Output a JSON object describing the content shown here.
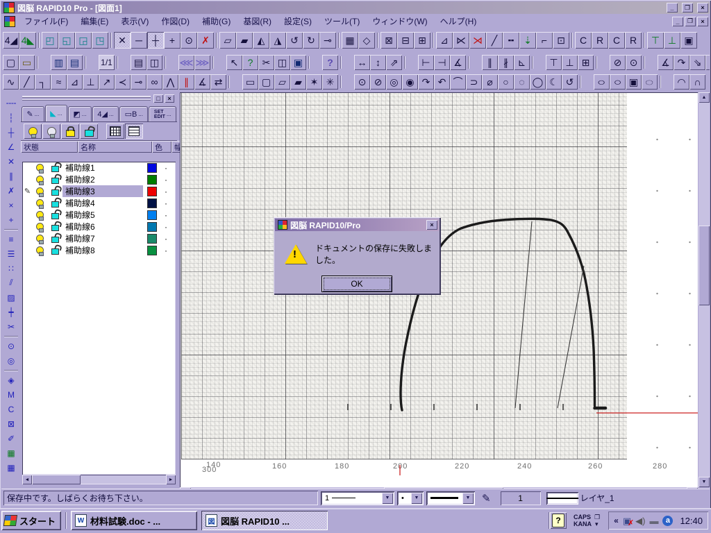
{
  "window": {
    "title": "図脳 RAPID10 Pro - [図面1]",
    "buttons": {
      "minimize": "_",
      "restore": "❐",
      "close": "×"
    }
  },
  "menu": {
    "items": [
      {
        "n": "menu-file",
        "label": "ファイル(F)"
      },
      {
        "n": "menu-edit",
        "label": "編集(E)"
      },
      {
        "n": "menu-view",
        "label": "表示(V)"
      },
      {
        "n": "menu-draw",
        "label": "作図(D)"
      },
      {
        "n": "menu-assist",
        "label": "補助(G)"
      },
      {
        "n": "menu-basefig",
        "label": "基図(R)"
      },
      {
        "n": "menu-settings",
        "label": "設定(S)"
      },
      {
        "n": "menu-tools",
        "label": "ツール(T)"
      },
      {
        "n": "menu-window",
        "label": "ウィンドウ(W)"
      },
      {
        "n": "menu-help",
        "label": "ヘルプ(H)"
      }
    ]
  },
  "toolbar1": {
    "items": [
      {
        "n": "layer-edit-all-icon",
        "g": "4◢"
      },
      {
        "n": "layer-view-all-icon",
        "g": "4◣",
        "cls": "green"
      },
      {
        "n": "sep",
        "g": "",
        "cls": "sep"
      },
      {
        "n": "layer-stack-1-icon",
        "g": "◰",
        "cls": "teal"
      },
      {
        "n": "layer-stack-2-icon",
        "g": "◱",
        "cls": "teal"
      },
      {
        "n": "layer-stack-3-icon",
        "g": "◲",
        "cls": "teal"
      },
      {
        "n": "layer-stack-4-icon",
        "g": "◳",
        "cls": "teal"
      },
      {
        "n": "sep",
        "g": "",
        "cls": "sep"
      },
      {
        "n": "snap-free-icon",
        "g": "✕",
        "cls": "pressed"
      },
      {
        "n": "snap-endpoint-icon",
        "g": "─"
      },
      {
        "n": "snap-intersection-icon",
        "g": "┼",
        "cls": "pressed"
      },
      {
        "n": "snap-point-icon",
        "g": "+"
      },
      {
        "n": "snap-center-icon",
        "g": "⊙"
      },
      {
        "n": "snap-none-icon",
        "g": "✗",
        "cls": "red"
      },
      {
        "n": "sep",
        "g": "",
        "cls": "sep"
      },
      {
        "n": "shape-copy-icon",
        "g": "▱"
      },
      {
        "n": "shape-move-icon",
        "g": "▰"
      },
      {
        "n": "mirror-left-icon",
        "g": "◭"
      },
      {
        "n": "mirror-right-icon",
        "g": "◮"
      },
      {
        "n": "rotate-ccw-icon",
        "g": "↺"
      },
      {
        "n": "rotate-cw-icon",
        "g": "↻"
      },
      {
        "n": "stretch-icon",
        "g": "⊸"
      },
      {
        "n": "sep",
        "g": "",
        "cls": "sep"
      },
      {
        "n": "array-grid-icon",
        "g": "▦"
      },
      {
        "n": "array-ref-icon",
        "g": "◇"
      },
      {
        "n": "sep",
        "g": "",
        "cls": "sep"
      },
      {
        "n": "erase-partial-icon",
        "g": "⊠"
      },
      {
        "n": "erase-region-icon",
        "g": "⊟"
      },
      {
        "n": "erase-all-icon",
        "g": "⊞"
      },
      {
        "n": "sep",
        "g": "",
        "cls": "sep"
      },
      {
        "n": "trim-corner-icon",
        "g": "⊿"
      },
      {
        "n": "trim-cross-icon",
        "g": "⋉"
      },
      {
        "n": "trim-cut-icon",
        "g": "⋊",
        "cls": "red"
      },
      {
        "n": "line-extend-icon",
        "g": "╱"
      },
      {
        "n": "line-break-icon",
        "g": "╍"
      },
      {
        "n": "divide-icon",
        "g": "⇣",
        "cls": "green"
      },
      {
        "n": "corner-edit-icon",
        "g": "⌐"
      },
      {
        "n": "region-box-icon",
        "g": "⊡"
      },
      {
        "n": "sep",
        "g": "",
        "cls": "sep"
      },
      {
        "n": "copy-attr-c-icon",
        "g": "C"
      },
      {
        "n": "copy-attr-r-icon",
        "g": "R"
      },
      {
        "n": "paste-attr-c-icon",
        "g": "C"
      },
      {
        "n": "paste-attr-r-icon",
        "g": "R"
      },
      {
        "n": "sep",
        "g": "",
        "cls": "sep"
      },
      {
        "n": "align-top-icon",
        "g": "⊤",
        "cls": "green"
      },
      {
        "n": "align-bottom-icon",
        "g": "⊥",
        "cls": "green"
      },
      {
        "n": "group-icon",
        "g": "▣"
      }
    ]
  },
  "toolbar2": {
    "items": [
      {
        "n": "new-document-icon",
        "g": "▢"
      },
      {
        "n": "open-document-icon",
        "g": "▭",
        "cls": "folder"
      },
      {
        "n": "sep",
        "g": "",
        "cls": "sep"
      },
      {
        "n": "save-icon",
        "g": "▥",
        "cls": "navy"
      },
      {
        "n": "save-page-icon",
        "g": "▤",
        "cls": "navy"
      },
      {
        "n": "sep",
        "g": "",
        "cls": "sep"
      },
      {
        "n": "page-indicator",
        "g": "1/1",
        "cls": "page"
      },
      {
        "n": "sep",
        "g": "",
        "cls": "sep"
      },
      {
        "n": "print-icon",
        "g": "▤"
      },
      {
        "n": "print-preview-icon",
        "g": "◫"
      },
      {
        "n": "sep",
        "g": "",
        "cls": "sep"
      },
      {
        "n": "undo-icon",
        "g": "⋘",
        "cls": "purple"
      },
      {
        "n": "redo-icon",
        "g": "⋙",
        "cls": "purple"
      },
      {
        "n": "sep",
        "g": "",
        "cls": "sep"
      },
      {
        "n": "select-cursor-icon",
        "g": "↖"
      },
      {
        "n": "zoom-query-icon",
        "g": "?",
        "cls": "green"
      },
      {
        "n": "cut-icon",
        "g": "✂"
      },
      {
        "n": "copy-icon",
        "g": "◫"
      },
      {
        "n": "paste-icon",
        "g": "▣",
        "cls": "navy"
      },
      {
        "n": "sep",
        "g": "",
        "cls": "sep"
      },
      {
        "n": "context-help-icon",
        "g": "?",
        "cls": "help"
      },
      {
        "n": "sep",
        "g": "",
        "cls": "sep"
      },
      {
        "n": "dim-horizontal-icon",
        "g": "↔"
      },
      {
        "n": "dim-vertical-icon",
        "g": "↕"
      },
      {
        "n": "dim-rotated-icon",
        "g": "⇗"
      },
      {
        "n": "sep",
        "g": "",
        "cls": "sep"
      },
      {
        "n": "dim-length-icon",
        "g": "⊢"
      },
      {
        "n": "dim-offset-icon",
        "g": "⊣"
      },
      {
        "n": "dim-angle3-icon",
        "g": "∡"
      },
      {
        "n": "sep",
        "g": "",
        "cls": "sep"
      },
      {
        "n": "dim-parallel-icon",
        "g": "∥"
      },
      {
        "n": "dim-chain-icon",
        "g": "∦"
      },
      {
        "n": "dim-baseline-icon",
        "g": "⊾"
      },
      {
        "n": "sep",
        "g": "",
        "cls": "sep"
      },
      {
        "n": "dim-ordinate-icon",
        "g": "⊤"
      },
      {
        "n": "dim-leader-icon",
        "g": "⊥"
      },
      {
        "n": "dim-box-icon",
        "g": "⊞"
      },
      {
        "n": "sep",
        "g": "",
        "cls": "sep"
      },
      {
        "n": "dim-diameter-icon",
        "g": "⊘"
      },
      {
        "n": "dim-radius-icon",
        "g": "⊙"
      },
      {
        "n": "sep",
        "g": "",
        "cls": "sep"
      },
      {
        "n": "dim-angle-icon",
        "g": "∡"
      },
      {
        "n": "dim-arc-icon",
        "g": "↷"
      },
      {
        "n": "dim-note-icon",
        "g": "⇘"
      },
      {
        "n": "dim-tolerance-icon",
        "g": "#"
      }
    ]
  },
  "toolbar3": {
    "items": [
      {
        "n": "polyline-icon",
        "g": "∿"
      },
      {
        "n": "line-icon",
        "g": "╱"
      },
      {
        "n": "bent-line-icon",
        "g": "┐"
      },
      {
        "n": "spline-icon",
        "g": "≈"
      },
      {
        "n": "angle-line-icon",
        "g": "⊿"
      },
      {
        "n": "perpendicular-line-icon",
        "g": "⊥"
      },
      {
        "n": "arrow-line-icon",
        "g": "↗"
      },
      {
        "n": "bisector-icon",
        "g": "≺"
      },
      {
        "n": "tangent-line-icon",
        "g": "⊸"
      },
      {
        "n": "two-circle-tangent-icon",
        "g": "∞"
      },
      {
        "n": "double-peak-icon",
        "g": "⋀"
      },
      {
        "n": "hatch-lines-icon",
        "g": "∥",
        "cls": "red"
      },
      {
        "n": "angle-mark-icon",
        "g": "∡"
      },
      {
        "n": "swap-line-icon",
        "g": "⇄"
      },
      {
        "n": "sep",
        "g": "",
        "cls": "sep"
      },
      {
        "n": "rectangle-icon",
        "g": "▭"
      },
      {
        "n": "rounded-rect-icon",
        "g": "▢"
      },
      {
        "n": "parallelogram-icon",
        "g": "▱"
      },
      {
        "n": "rect-3point-icon",
        "g": "▰"
      },
      {
        "n": "polygon-icon",
        "g": "✶"
      },
      {
        "n": "polygon-star-icon",
        "g": "✳"
      },
      {
        "n": "sep",
        "g": "",
        "cls": "sep"
      },
      {
        "n": "circle-center-icon",
        "g": "⊙"
      },
      {
        "n": "circle-diameter-icon",
        "g": "⊘"
      },
      {
        "n": "circle-2point-icon",
        "g": "◎"
      },
      {
        "n": "concentric-circle-icon",
        "g": "◉"
      },
      {
        "n": "arc-start-icon",
        "g": "↷"
      },
      {
        "n": "arc-3point-icon",
        "g": "↶"
      },
      {
        "n": "arc-tangent-icon",
        "g": "⌒"
      },
      {
        "n": "circle-tangent-icon",
        "g": "⊃"
      },
      {
        "n": "circle-cut-icon",
        "g": "⌀"
      },
      {
        "n": "circle-open-icon",
        "g": "○"
      },
      {
        "n": "circle-point-icon",
        "g": "◌"
      },
      {
        "n": "circle-large-icon",
        "g": "◯"
      },
      {
        "n": "circle-gap-icon",
        "g": "☾"
      },
      {
        "n": "circle-rotate-icon",
        "g": "↺"
      },
      {
        "n": "sep",
        "g": "",
        "cls": "sep"
      },
      {
        "n": "ellipse-icon",
        "g": "○",
        "cls": "ellipse"
      },
      {
        "n": "ellipse-rotated-icon",
        "g": "○",
        "cls": "ellipse tilt"
      },
      {
        "n": "ellipse-box-icon",
        "g": "▣"
      },
      {
        "n": "ellipse-dashed-icon",
        "g": "◌",
        "cls": "ellipse"
      },
      {
        "n": "sep",
        "g": "",
        "cls": "sep"
      },
      {
        "n": "arc-icon",
        "g": "◠"
      },
      {
        "n": "arc-wave-icon",
        "g": "∩"
      }
    ]
  },
  "side_toolbar": {
    "items": [
      {
        "n": "aux-dash-icon",
        "g": "╌╌"
      },
      {
        "n": "aux-vline-icon",
        "g": "┆"
      },
      {
        "n": "aux-cross-icon",
        "g": "┼"
      },
      {
        "n": "aux-angle-icon",
        "g": "∠"
      },
      {
        "n": "aux-xpoint-icon",
        "g": "✕"
      },
      {
        "n": "aux-parallel-icon",
        "g": "∥"
      },
      {
        "n": "aux-cross2-icon",
        "g": "✗"
      },
      {
        "n": "aux-x-icon",
        "g": "×"
      },
      {
        "n": "aux-plus-icon",
        "g": "+"
      },
      {
        "n": "sep",
        "g": "",
        "cls": "sep"
      },
      {
        "n": "grid-rows-icon",
        "g": "≡"
      },
      {
        "n": "grid-bars-icon",
        "g": "☰"
      },
      {
        "n": "grid-dots-icon",
        "g": "∷"
      },
      {
        "n": "hatch-diag-icon",
        "g": "⫽"
      },
      {
        "n": "hatch-cross-icon",
        "g": "▨"
      },
      {
        "n": "marker-plus-icon",
        "g": "┿"
      },
      {
        "n": "cut-marks-icon",
        "g": "✂"
      },
      {
        "n": "sep",
        "g": "",
        "cls": "sep"
      },
      {
        "n": "circle-dot-icon",
        "g": "⊙"
      },
      {
        "n": "circle-double-icon",
        "g": "◎"
      },
      {
        "n": "sep",
        "g": "",
        "cls": "sep"
      },
      {
        "n": "point-diamond-icon",
        "g": "◈"
      },
      {
        "n": "box-m-icon",
        "g": "M"
      },
      {
        "n": "box-c-icon",
        "g": "C"
      },
      {
        "n": "erase-small-icon",
        "g": "⊠"
      },
      {
        "n": "mouse-icon",
        "g": "✐"
      },
      {
        "n": "window-green-icon",
        "g": "▦",
        "cls": "green"
      },
      {
        "n": "window-blue-icon",
        "g": "▦"
      }
    ]
  },
  "palette": {
    "window_buttons": {
      "maximize": "□",
      "close": "×"
    },
    "tabs": [
      {
        "n": "tab-pen",
        "icon": "✎",
        "dots": "..."
      },
      {
        "n": "tab-layers",
        "icon": "◣",
        "dots": "...",
        "cls": "active cyan"
      },
      {
        "n": "tab-figure",
        "icon": "◩",
        "dots": "..."
      },
      {
        "n": "tab-parts",
        "icon": "4◢",
        "dots": "..."
      },
      {
        "n": "tab-block",
        "icon": "▭B",
        "dots": "..."
      },
      {
        "n": "tab-set-edit",
        "icon": "SET\nEDIT",
        "dots": "...",
        "cls": "text"
      }
    ],
    "columns": [
      {
        "n": "col-status",
        "t": "状態",
        "style": "width:78px"
      },
      {
        "n": "col-name",
        "t": "名称",
        "style": "width:103px"
      },
      {
        "n": "col-color",
        "t": "色",
        "style": "width:24px"
      },
      {
        "n": "col-width",
        "t": "幅",
        "style": "width:16px"
      }
    ],
    "rows": [
      {
        "n": "layer-row-1",
        "name": "補助線1",
        "chip": "background:#0008e0",
        "marker": "",
        "cls": "",
        "dot": "·"
      },
      {
        "n": "layer-row-2",
        "name": "補助線2",
        "chip": "background:#007d00",
        "marker": "",
        "cls": "",
        "dot": "·"
      },
      {
        "n": "layer-row-3",
        "name": "補助線3",
        "chip": "background:#ee0000",
        "marker": "✎",
        "cls": "sel",
        "dot": "·"
      },
      {
        "n": "layer-row-4",
        "name": "補助線4",
        "chip": "background:#001245",
        "marker": "",
        "cls": "",
        "dot": "·"
      },
      {
        "n": "layer-row-5",
        "name": "補助線5",
        "chip": "background:#0080f0",
        "marker": "",
        "cls": "",
        "dot": "·"
      },
      {
        "n": "layer-row-6",
        "name": "補助線6",
        "chip": "background:#0078b0",
        "marker": "",
        "cls": "",
        "dot": "·"
      },
      {
        "n": "layer-row-7",
        "name": "補助線7",
        "chip": "background:#1a8a6a",
        "marker": "",
        "cls": "",
        "dot": "·"
      },
      {
        "n": "layer-row-8",
        "name": "補助線8",
        "chip": "background:#089040",
        "marker": "",
        "cls": "",
        "dot": "·"
      }
    ]
  },
  "drawing": {
    "axis_labels": [
      {
        "n": "axis-label-140",
        "t": "140",
        "style": "left:36px;top:2px"
      },
      {
        "n": "axis-label-300",
        "t": "300",
        "style": "left:30px;top:9px"
      },
      {
        "n": "axis-label-160",
        "t": "160",
        "style": "left:131px;top:4px"
      },
      {
        "n": "axis-label-180",
        "t": "180",
        "style": "left:221px;top:4px"
      },
      {
        "n": "axis-label-200",
        "t": "200",
        "style": "left:305px;top:4px"
      },
      {
        "n": "axis-label-220",
        "t": "220",
        "style": "left:394px;top:4px"
      },
      {
        "n": "axis-label-240",
        "t": "240",
        "style": "left:484px;top:4px"
      },
      {
        "n": "axis-label-260",
        "t": "260",
        "style": "left:586px;top:4px"
      },
      {
        "n": "axis-label-280",
        "t": "280",
        "style": "left:679px;top:4px"
      }
    ]
  },
  "dialog": {
    "title": "図脳 RAPID10/Pro",
    "close": "×",
    "message": "ドキュメントの保存に失敗しました。",
    "ok_label": "OK"
  },
  "statusbar": {
    "message": "保存中です。しばらくお待ち下さい。",
    "line_width_value": "1",
    "point_style": "•",
    "pen_number": "1",
    "layer_name": "レイヤ_1"
  },
  "taskbar": {
    "start_label": "スタート",
    "tasks": [
      {
        "n": "task-word-document",
        "label": "材料試験.doc - ...",
        "icon": "W",
        "cls": ""
      },
      {
        "n": "task-zuno-rapid",
        "label": "図脳 RAPID10 ...",
        "icon": "図",
        "cls": "active"
      }
    ],
    "ime_caps": "CAPS",
    "ime_kana": "KANA",
    "tray_chevron": "«",
    "clock": "12:40"
  }
}
